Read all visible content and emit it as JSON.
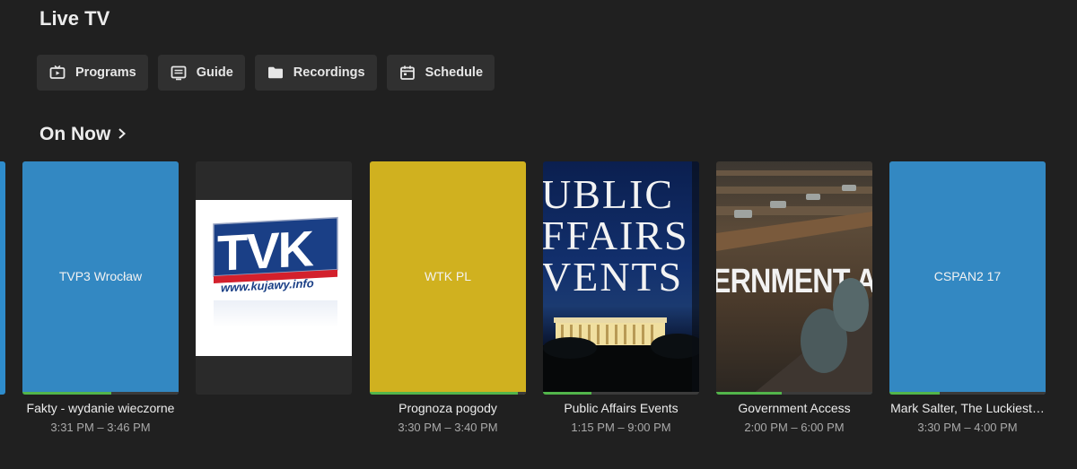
{
  "page": {
    "title": "Live TV"
  },
  "toolbar": {
    "programs": {
      "label": "Programs",
      "icon": "tv-icon"
    },
    "guide": {
      "label": "Guide",
      "icon": "guide-icon"
    },
    "recordings": {
      "label": "Recordings",
      "icon": "folder-icon"
    },
    "schedule": {
      "label": "Schedule",
      "icon": "calendar-icon"
    }
  },
  "section": {
    "title": "On Now",
    "icon": "chevron-right-icon"
  },
  "colors": {
    "background": "#202020",
    "button_bg": "#303030",
    "progress": "#52b54b",
    "tile_blue": "#3388c2",
    "tile_yellow": "#d0b11f"
  },
  "cards": [
    {
      "channel_label": "TVP3 Wrocław",
      "title": "Fakty - wydanie wieczorne",
      "time": "3:31 PM – 3:46 PM",
      "tile_color": "#3388c2",
      "progress": 0.57
    },
    {
      "channel_label": "",
      "title": "",
      "time": "",
      "tile_color": "#2a2a2a",
      "logo_text": "TVK",
      "logo_url_text": "www.kujawy.info",
      "progress": 0
    },
    {
      "channel_label": "WTK PL",
      "title": "Prognoza pogody",
      "time": "3:30 PM – 3:40 PM",
      "tile_color": "#d0b11f",
      "progress": 0.95
    },
    {
      "channel_label": "",
      "title": "Public Affairs Events",
      "time": "1:15 PM – 9:00 PM",
      "art_text": [
        "UBLIC",
        "FFAIRS",
        "VENTS"
      ],
      "progress": 0.31
    },
    {
      "channel_label": "",
      "title": "Government Access",
      "time": "2:00 PM – 6:00 PM",
      "art_text": "ERNMENT ACC",
      "progress": 0.42
    },
    {
      "channel_label": "CSPAN2 17",
      "title": "Mark Salter, The Luckiest…",
      "time": "3:30 PM – 4:00 PM",
      "tile_color": "#3388c2",
      "progress": 0.32
    }
  ]
}
